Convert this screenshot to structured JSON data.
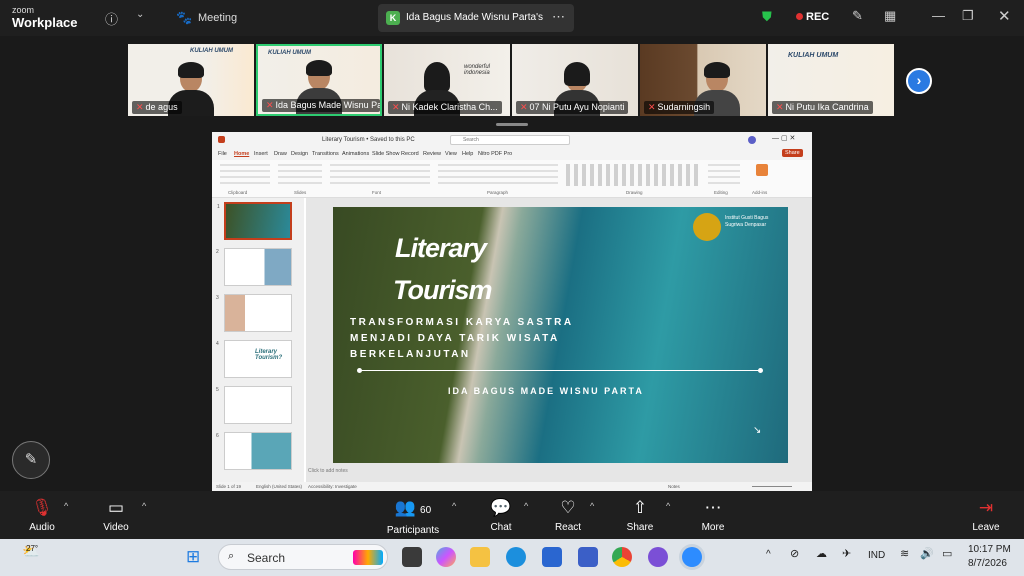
{
  "app": {
    "brand_top": "zoom",
    "brand_bottom": "Workplace",
    "meeting_label": "Meeting",
    "rec_label": "REC"
  },
  "share_tab": {
    "initial": "K",
    "title": "Ida Bagus Made Wisnu Parta's scr"
  },
  "participants": [
    {
      "name": "de agus",
      "banner": "KULIAH UMUM"
    },
    {
      "name": "Ida Bagus Made Wisnu Pa...",
      "banner": "KULIAH UMUM",
      "active": true
    },
    {
      "name": "Ni Kadek Claristha Ch...",
      "banner": "wonderful indonesia"
    },
    {
      "name": "07 Ni Putu Ayu Nopianti",
      "banner": ""
    },
    {
      "name": "Sudarningsih",
      "banner": ""
    },
    {
      "name": "Ni Putu Ika Candrina",
      "banner": "KULIAH UMUM"
    }
  ],
  "ppt": {
    "file_title": "Literary Tourism • Saved to this PC",
    "search_placeholder": "Search",
    "tabs": [
      "File",
      "Home",
      "Insert",
      "Draw",
      "Design",
      "Transitions",
      "Animations",
      "Slide Show",
      "Record",
      "Review",
      "View",
      "Help",
      "Nitro PDF Pro"
    ],
    "share_btn": "Share",
    "ribbon_groups": [
      "Clipboard",
      "Slides",
      "Font",
      "Paragraph",
      "Drawing",
      "Editing",
      "Add-ins"
    ],
    "slide": {
      "title1": "Literary",
      "title2": "Tourism",
      "subtitle": "TRANSFORMASI KARYA SASTRA MENJADI DAYA TARIK WISATA BERKELANJUTAN",
      "author": "IDA BAGUS MADE WISNU PARTA",
      "institution": "Institut Gusti Bagus Sugriwa Denpasar"
    },
    "notes_placeholder": "Click to add notes",
    "status_left": "Slide 1 of 19",
    "status_lang": "English (United States)",
    "status_access": "Accessibility: Investigate",
    "status_notes": "Notes"
  },
  "toolbar": {
    "audio": "Audio",
    "video": "Video",
    "participants": "Participants",
    "participants_count": "60",
    "chat": "Chat",
    "react": "React",
    "share": "Share",
    "more": "More",
    "leave": "Leave"
  },
  "taskbar": {
    "weather": "27°",
    "search": "Search",
    "lang": "IND",
    "time": "10:17 PM",
    "date": "8/7/2026"
  }
}
